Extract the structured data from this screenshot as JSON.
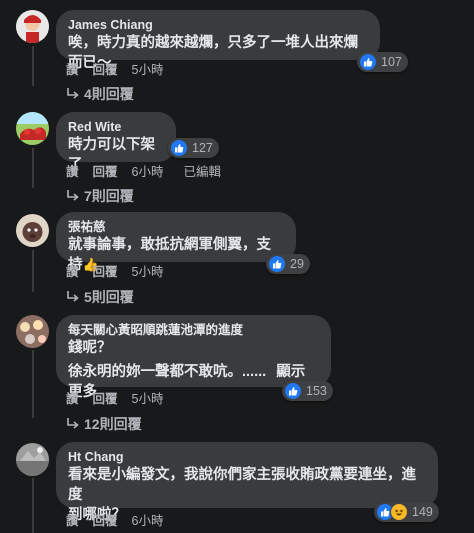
{
  "comments": [
    {
      "author": "James Chiang",
      "lines": [
        "唉，時力真的越來越爛，只多了一堆人出來爛而已～"
      ],
      "reactions": 107,
      "actions": [
        "讚",
        "回覆",
        "5小時"
      ],
      "replies": "4則回覆"
    },
    {
      "author": "Red Wite",
      "lines": [
        "時力可以下架了"
      ],
      "reactions": 127,
      "actions": [
        "讚",
        "回覆",
        "6小時",
        "已編輯"
      ],
      "replies": "7則回覆"
    },
    {
      "author": "張祐慈",
      "lines": [
        "就事論事，敢抵抗網軍側翼，支持"
      ],
      "reactions": 29,
      "actions": [
        "讚",
        "回覆",
        "5小時"
      ],
      "replies": "5則回覆"
    },
    {
      "author": "每天關心黃昭順跳蓮池潭的進度",
      "lines": [
        "錢呢？",
        "徐永明的妳一聲都不敢吭。......",
        "顯示更多"
      ],
      "reactions": 153,
      "actions": [
        "讚",
        "回覆",
        "5小時"
      ],
      "replies": "12則回覆"
    },
    {
      "author": "Ht Chang",
      "lines": [
        "看來是小編發文，我說你們家主張收賄政黨要連坐，進度",
        "到哪啦？"
      ],
      "reactions": 149,
      "actions": [
        "讚",
        "回覆",
        "6小時"
      ],
      "replies": ""
    }
  ]
}
